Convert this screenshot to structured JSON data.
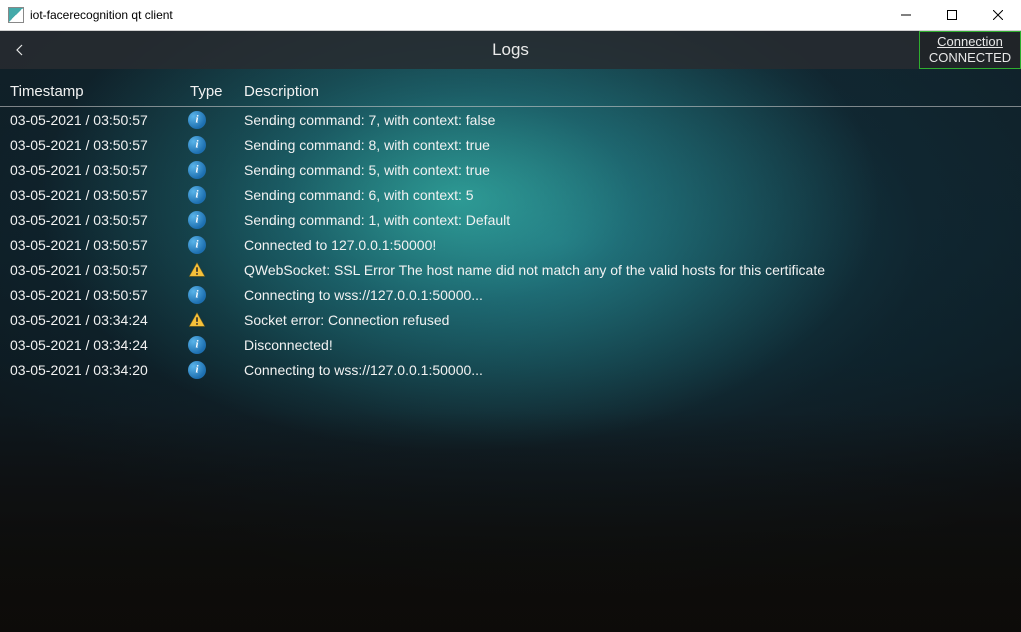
{
  "window": {
    "title": "iot-facerecognition qt client"
  },
  "header": {
    "title": "Logs",
    "connection": {
      "label": "Connection",
      "status": "CONNECTED"
    }
  },
  "table": {
    "columns": {
      "timestamp": "Timestamp",
      "type": "Type",
      "description": "Description"
    },
    "rows": [
      {
        "timestamp": "03-05-2021 / 03:50:57",
        "type": "info",
        "description": "Sending command: 7, with context: false"
      },
      {
        "timestamp": "03-05-2021 / 03:50:57",
        "type": "info",
        "description": "Sending command: 8, with context: true"
      },
      {
        "timestamp": "03-05-2021 / 03:50:57",
        "type": "info",
        "description": "Sending command: 5, with context: true"
      },
      {
        "timestamp": "03-05-2021 / 03:50:57",
        "type": "info",
        "description": "Sending command: 6, with context: 5"
      },
      {
        "timestamp": "03-05-2021 / 03:50:57",
        "type": "info",
        "description": "Sending command: 1, with context: Default"
      },
      {
        "timestamp": "03-05-2021 / 03:50:57",
        "type": "info",
        "description": "Connected to 127.0.0.1:50000!"
      },
      {
        "timestamp": "03-05-2021 / 03:50:57",
        "type": "warn",
        "description": "QWebSocket: SSL Error The host name did not match any of the valid hosts for this certificate"
      },
      {
        "timestamp": "03-05-2021 / 03:50:57",
        "type": "info",
        "description": "Connecting to wss://127.0.0.1:50000..."
      },
      {
        "timestamp": "03-05-2021 / 03:34:24",
        "type": "warn",
        "description": "Socket error: Connection refused"
      },
      {
        "timestamp": "03-05-2021 / 03:34:24",
        "type": "info",
        "description": "Disconnected!"
      },
      {
        "timestamp": "03-05-2021 / 03:34:20",
        "type": "info",
        "description": "Connecting to wss://127.0.0.1:50000..."
      }
    ]
  },
  "colors": {
    "connected_border": "#2fae2f"
  }
}
